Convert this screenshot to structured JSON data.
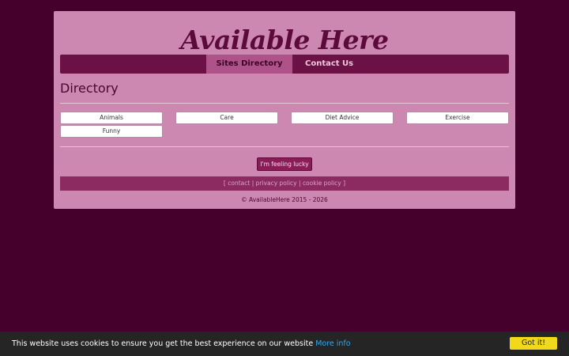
{
  "site": {
    "title": "Available Here"
  },
  "nav": {
    "items": [
      {
        "label": "Sites Directory",
        "active": true
      },
      {
        "label": "Contact Us",
        "active": false
      }
    ]
  },
  "directory": {
    "heading": "Directory",
    "categories": [
      "Animals",
      "Care",
      "Diet Advice",
      "Exercise",
      "Funny"
    ]
  },
  "lucky_button": "I'm feeling lucky",
  "footer": {
    "open_bracket": "[",
    "close_bracket": "]",
    "separator": "|",
    "links": [
      "contact",
      "privacy policy",
      "cookie policy"
    ],
    "copyright": "© AvailableHere 2015 - 2026"
  },
  "cookie_bar": {
    "message": "This website uses cookies to ensure you get the best experience on our website",
    "more_info": "More info",
    "accept": "Got it!"
  },
  "colors": {
    "page_background": "#45002c",
    "panel": "#cd88b2",
    "nav_bar": "#6b1145",
    "nav_active": "#b0528a",
    "link_bar": "#8b2b62",
    "lucky_button": "#8a1d58",
    "cookie_accept": "#f0d81a",
    "cookie_link": "#35a8e8"
  }
}
